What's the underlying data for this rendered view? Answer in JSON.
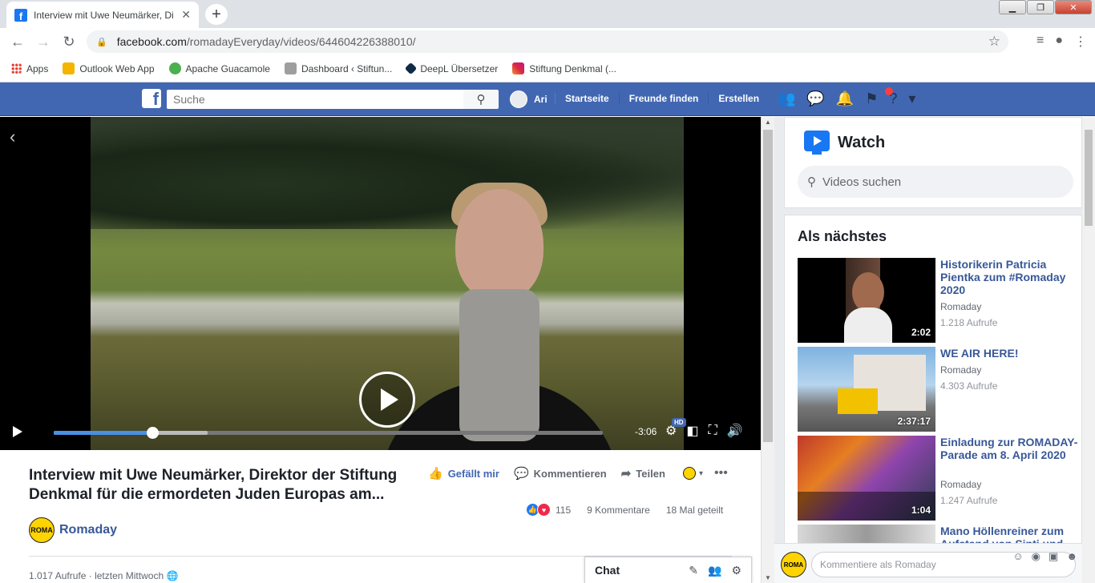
{
  "browser": {
    "tab_title": "Interview mit Uwe Neumärker, Di",
    "url_host": "facebook.com",
    "url_path": "/romadayEveryday/videos/644604226388010/",
    "bookmarks": [
      {
        "label": "Apps",
        "color": "#ea4335"
      },
      {
        "label": "Outlook Web App",
        "color": "#f4b400"
      },
      {
        "label": "Apache Guacamole",
        "color": "#4caf50"
      },
      {
        "label": "Dashboard ‹ Stiftun...",
        "color": "#9e9e9e"
      },
      {
        "label": "DeepL Übersetzer",
        "color": "#0f2b46"
      },
      {
        "label": "Stiftung Denkmal (...",
        "color": "#c13584"
      }
    ]
  },
  "fb_header": {
    "logo": "f",
    "search_placeholder": "Suche",
    "user_name": "Ari",
    "nav": [
      "Startseite",
      "Freunde finden",
      "Erstellen"
    ],
    "brand_color": "#4267b2"
  },
  "video": {
    "time_remaining": "-3:06",
    "quality_badge": "HD",
    "progress_played": 0.18,
    "progress_buffered": 0.28
  },
  "post": {
    "title": "Interview mit Uwe Neumärker, Direktor der Stiftung Denkmal für die ermordeten Juden Europas am...",
    "actions": {
      "like": "Gefällt mir",
      "comment": "Kommentieren",
      "share": "Teilen"
    },
    "reactions_count": "115",
    "comments_count": "9 Kommentare",
    "shares_count": "18 Mal geteilt",
    "page_name": "Romaday",
    "page_logo_text": "ROMA",
    "views": "1.017 Aufrufe",
    "date": "letzten Mittwoch",
    "separator": "·"
  },
  "chat": {
    "label": "Chat"
  },
  "watch": {
    "title": "Watch",
    "search_placeholder": "Videos suchen",
    "next_heading": "Als nächstes",
    "videos": [
      {
        "title": "Historikerin Patricia Pientka zum #Romaday 2020",
        "page": "Romaday",
        "views": "1.218 Aufrufe",
        "duration": "2:02"
      },
      {
        "title": "WE AIR HERE!",
        "page": "Romaday",
        "views": "4.303 Aufrufe",
        "duration": "2:37:17"
      },
      {
        "title": "Einladung zur ROMADAY-Parade am 8. April 2020",
        "page": "Romaday",
        "views": "1.247 Aufrufe",
        "duration": "1:04"
      },
      {
        "title": "Mano Höllenreiner zum Aufstand von Sinti und",
        "page": "",
        "views": "",
        "duration": ""
      }
    ],
    "comment_placeholder": "Kommentiere als Romaday",
    "comment_logo_text": "ROMA"
  }
}
